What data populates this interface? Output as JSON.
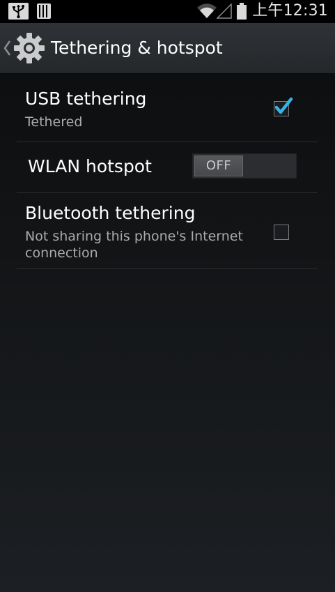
{
  "status_bar": {
    "time": "上午12:31",
    "icons": [
      "usb-icon",
      "sd-card-icon",
      "wifi-icon",
      "signal-icon",
      "battery-icon"
    ]
  },
  "action_bar": {
    "title": "Tethering & hotspot",
    "icon": "gear-icon"
  },
  "items": {
    "usb": {
      "title": "USB tethering",
      "summary": "Tethered",
      "checked": true
    },
    "wlan": {
      "title": "WLAN hotspot",
      "toggle_label": "OFF"
    },
    "bluetooth": {
      "title": "Bluetooth tethering",
      "summary": "Not sharing this phone's Internet connection",
      "checked": false
    }
  },
  "colors": {
    "accent": "#33b5e5",
    "background": "#121416",
    "action_bar": "#2a2d30"
  }
}
